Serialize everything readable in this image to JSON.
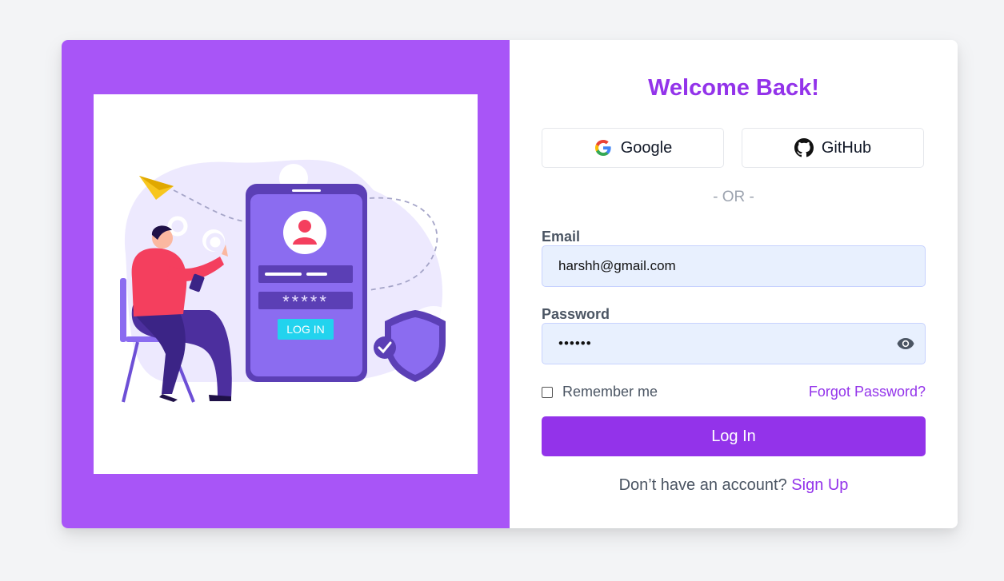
{
  "login": {
    "title": "Welcome Back!",
    "social": {
      "google_label": "Google",
      "github_label": "GitHub"
    },
    "divider": "- OR -",
    "email": {
      "label": "Email",
      "value": "harshh@gmail.com"
    },
    "password": {
      "label": "Password",
      "value": "••••••"
    },
    "remember_label": "Remember me",
    "forgot_label": "Forgot Password?",
    "submit_label": "Log In",
    "signup_prompt": "Don’t have an account?",
    "signup_link": "Sign Up"
  },
  "illustration": {
    "password_mask": "*****",
    "login_button": "LOG IN"
  },
  "colors": {
    "accent": "#9333ea",
    "panel": "#a855f7",
    "background": "#f3f4f6"
  }
}
